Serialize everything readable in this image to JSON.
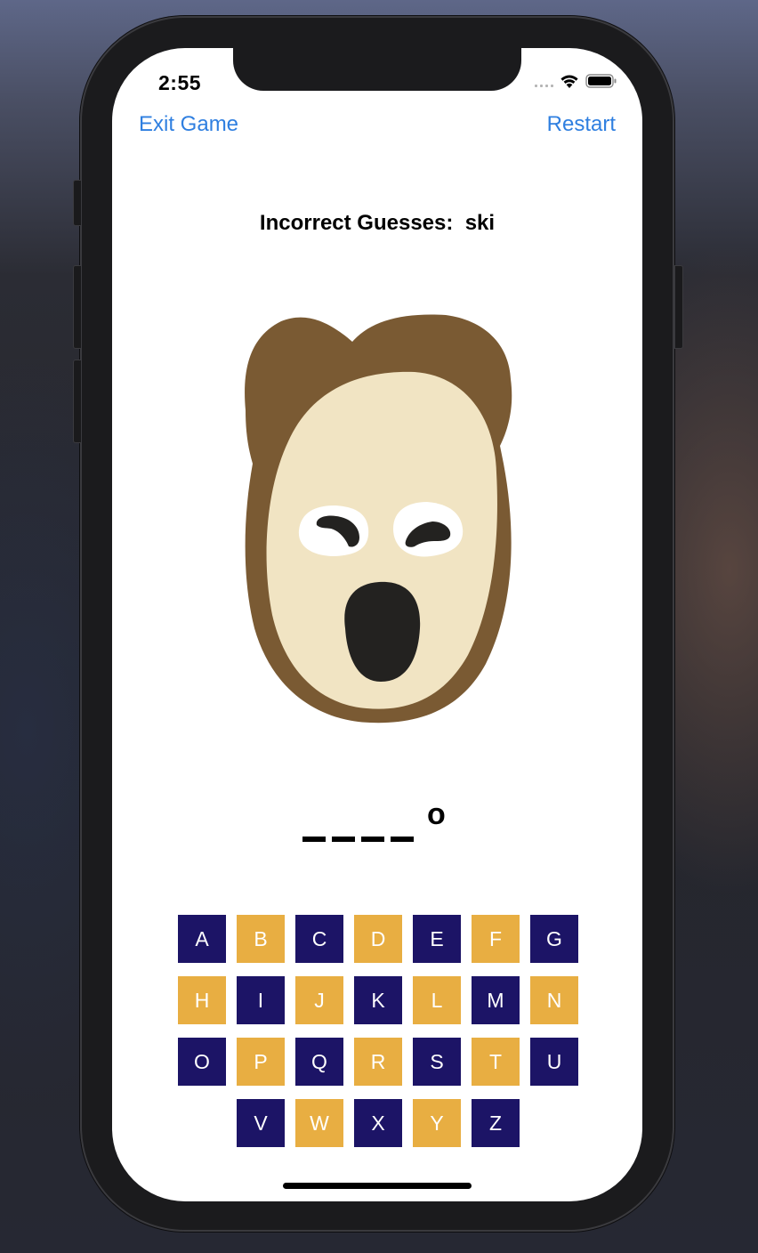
{
  "status_bar": {
    "time": "2:55"
  },
  "nav": {
    "left_label": "Exit Game",
    "right_label": "Restart",
    "link_color": "#2f7fe0"
  },
  "game": {
    "incorrect_guesses_label": "Incorrect Guesses:",
    "incorrect_guesses_value": "ski",
    "word_blanks": [
      "_",
      "_",
      "_",
      "_"
    ],
    "revealed_letter": "o",
    "keys": [
      "A",
      "B",
      "C",
      "D",
      "E",
      "F",
      "G",
      "H",
      "I",
      "J",
      "K",
      "L",
      "M",
      "N",
      "O",
      "P",
      "Q",
      "R",
      "S",
      "T",
      "U",
      "V",
      "W",
      "X",
      "Y",
      "Z"
    ],
    "key_colors": {
      "primary": "#1c1466",
      "secondary": "#e8ae42"
    }
  }
}
